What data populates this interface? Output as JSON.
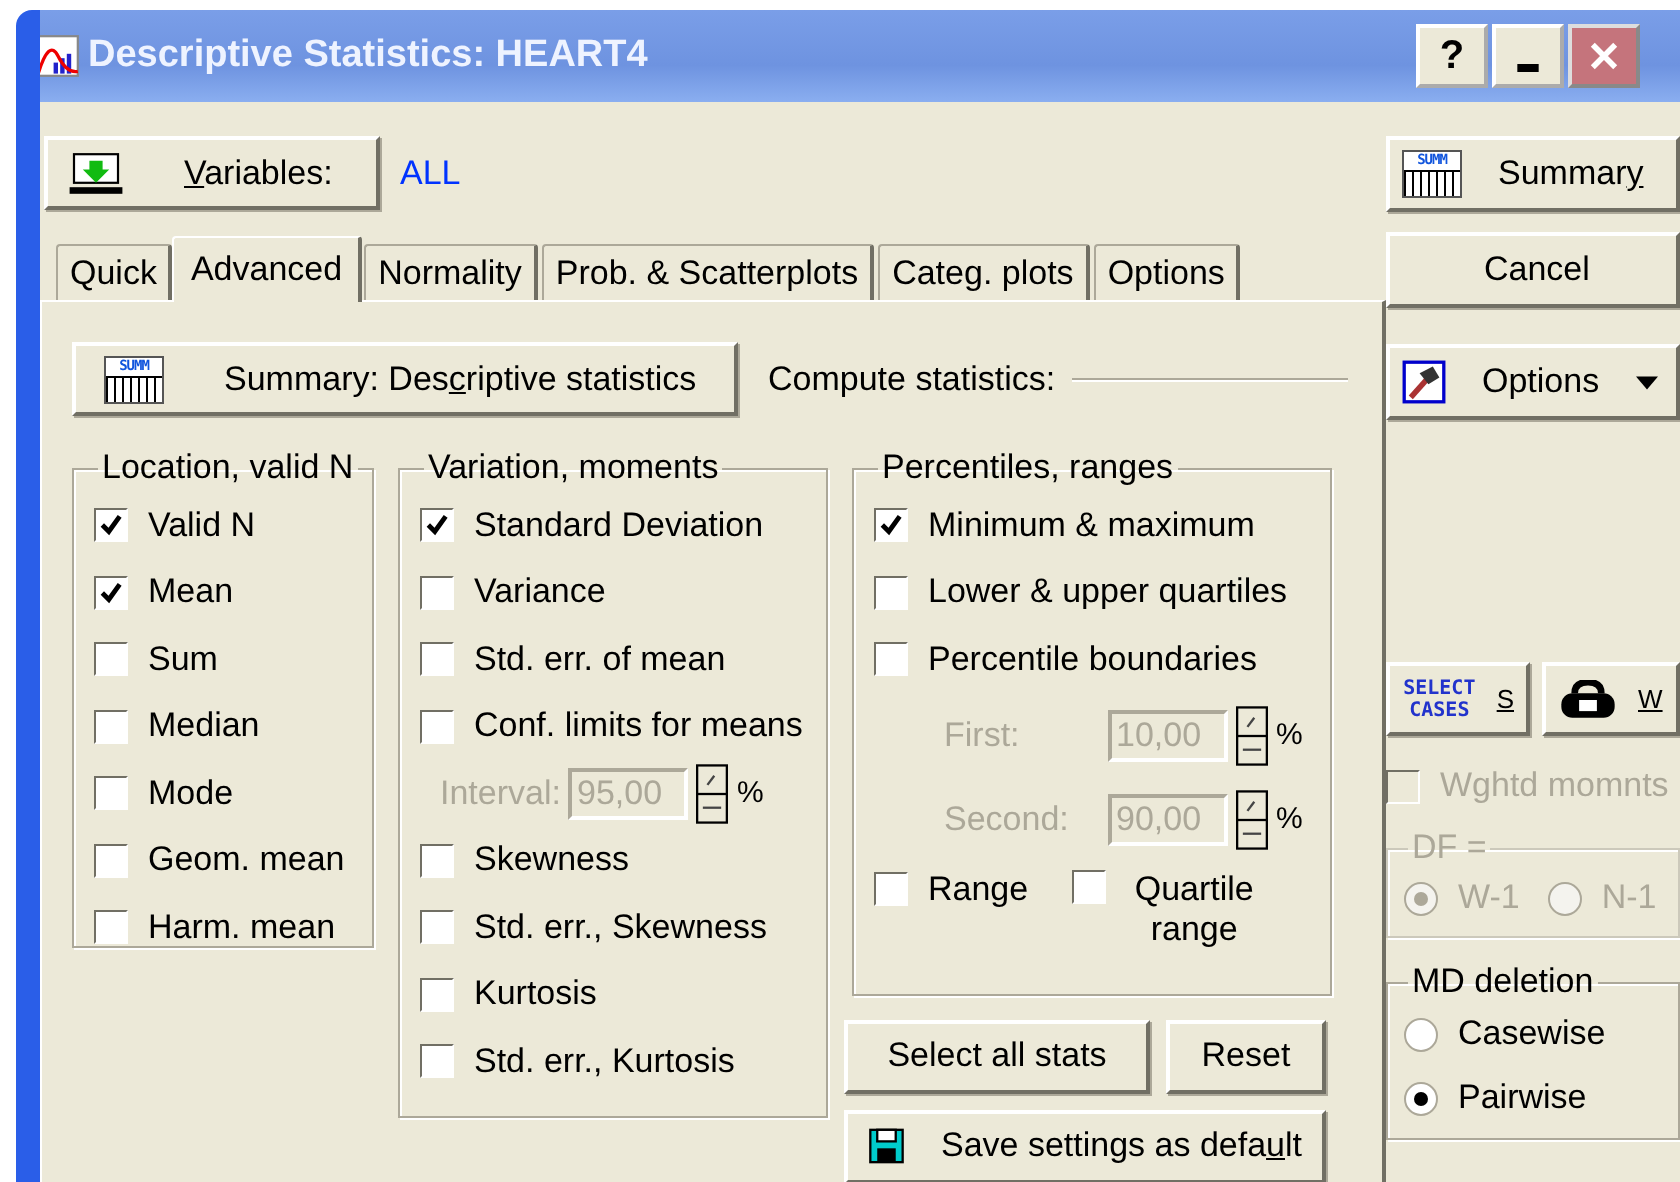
{
  "window": {
    "title": "Descriptive Statistics: HEART4",
    "help_label": "?"
  },
  "variables": {
    "button": {
      "label": {
        "key": "V",
        "post": "ariables:"
      }
    },
    "value": "ALL"
  },
  "tabs": [
    {
      "label": "Quick",
      "selected": false
    },
    {
      "label": "Advanced",
      "selected": true
    },
    {
      "label": "Normality",
      "selected": false
    },
    {
      "label": "Prob. & Scatterplots",
      "selected": false
    },
    {
      "label": "Categ. plots",
      "selected": false
    },
    {
      "label": "Options",
      "selected": false
    }
  ],
  "summary_button": {
    "label": {
      "pre": "Summary: Des",
      "key": "c",
      "post": "riptive statistics"
    },
    "icon_text": "SUMM"
  },
  "compute_label": "Compute statistics:",
  "groups": [
    {
      "title": "Location, valid N",
      "items": [
        {
          "kind": "check",
          "label": "Valid N",
          "checked": true
        },
        {
          "kind": "check",
          "label": "Mean",
          "checked": true
        },
        {
          "kind": "check",
          "label": "Sum",
          "checked": false
        },
        {
          "kind": "check",
          "label": "Median",
          "checked": false
        },
        {
          "kind": "check",
          "label": "Mode",
          "checked": false
        },
        {
          "kind": "check",
          "label": "Geom. mean",
          "checked": false
        },
        {
          "kind": "check",
          "label": "Harm. mean",
          "checked": false
        }
      ]
    },
    {
      "title": "Variation, moments",
      "items": [
        {
          "kind": "check",
          "label": "Standard Deviation",
          "checked": true
        },
        {
          "kind": "check",
          "label": "Variance",
          "checked": false
        },
        {
          "kind": "check",
          "label": "Std. err. of mean",
          "checked": false
        },
        {
          "kind": "check",
          "label": "Conf. limits for means",
          "checked": false
        },
        {
          "kind": "spin",
          "label": "Interval:",
          "value": "95,00",
          "unit": "%",
          "disabled": true
        },
        {
          "kind": "check",
          "label": "Skewness",
          "checked": false
        },
        {
          "kind": "check",
          "label": "Std. err., Skewness",
          "checked": false
        },
        {
          "kind": "check",
          "label": "Kurtosis",
          "checked": false
        },
        {
          "kind": "check",
          "label": "Std. err., Kurtosis",
          "checked": false
        }
      ]
    },
    {
      "title": "Percentiles, ranges",
      "items": [
        {
          "kind": "check",
          "label": "Minimum & maximum",
          "checked": true
        },
        {
          "kind": "check",
          "label": "Lower & upper quartiles",
          "checked": false
        },
        {
          "kind": "check",
          "label": "Percentile boundaries",
          "checked": false
        },
        {
          "kind": "spin",
          "label": "First:",
          "value": "10,00",
          "unit": "%",
          "disabled": true
        },
        {
          "kind": "spin",
          "label": "Second:",
          "value": "90,00",
          "unit": "%",
          "disabled": true
        },
        {
          "kind": "pair",
          "items": [
            {
              "label": "Range",
              "checked": false
            },
            {
              "label": "Quartile range",
              "checked": false
            }
          ]
        }
      ]
    }
  ],
  "panel_buttons": [
    {
      "label": "Select all stats"
    },
    {
      "label": "Reset"
    }
  ],
  "save_button": {
    "label": {
      "pre": "Save settings as defa",
      "key": "u",
      "post": "lt"
    }
  },
  "side": {
    "summary_button": {
      "label": {
        "pre": "Summar",
        "key": "y"
      },
      "icon_text": "SUMM"
    },
    "cancel_button": {
      "label": "Cancel"
    },
    "options_button": {
      "label": "Options"
    },
    "select_cases_button": {
      "icon_text": "SELECT CASES",
      "label": "S"
    },
    "weight_button": {
      "label": "W"
    },
    "weighted": {
      "label": "Wghtd momnts",
      "checked": false,
      "disabled": true
    },
    "df_group": {
      "title": "DF =",
      "disabled": true,
      "options": [
        {
          "label": "W-1",
          "selected": true
        },
        {
          "label": "N-1",
          "selected": false
        }
      ]
    },
    "md_group": {
      "title": "MD deletion",
      "options": [
        {
          "label": "Casewise",
          "selected": false
        },
        {
          "label": "Pairwise",
          "selected": true
        }
      ]
    }
  }
}
